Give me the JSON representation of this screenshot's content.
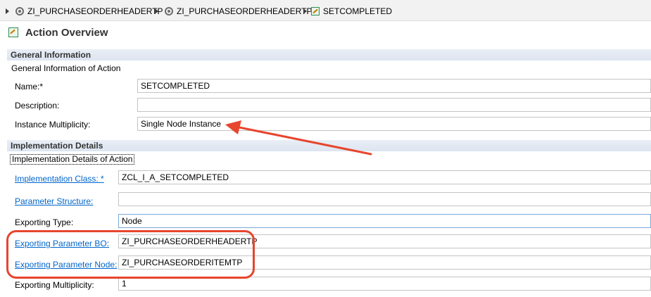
{
  "breadcrumb": {
    "items": [
      {
        "label": "ZI_PURCHASEORDERHEADERTP",
        "icon": "business-object-icon"
      },
      {
        "label": "ZI_PURCHASEORDERHEADERTP",
        "icon": "business-object-icon"
      },
      {
        "label": "SETCOMPLETED",
        "icon": "action-icon"
      }
    ]
  },
  "page": {
    "title": "Action Overview",
    "icon": "action-icon"
  },
  "general": {
    "header": "General Information",
    "description": "General Information of Action",
    "fields": {
      "name": {
        "label": "Name:*",
        "value": "SETCOMPLETED"
      },
      "description": {
        "label": "Description:",
        "value": ""
      },
      "instance_multiplicity": {
        "label": "Instance Multiplicity:",
        "value": "Single Node Instance"
      }
    }
  },
  "implementation": {
    "header": "Implementation Details",
    "description": "Implementation Details of Action",
    "fields": {
      "implementation_class": {
        "label": "Implementation Class: *",
        "value": "ZCL_I_A_SETCOMPLETED"
      },
      "parameter_structure": {
        "label": "Parameter Structure:",
        "value": ""
      },
      "exporting_type": {
        "label": "Exporting Type:",
        "value": "Node"
      },
      "exporting_parameter_bo": {
        "label": "Exporting Parameter BO:",
        "value": "ZI_PURCHASEORDERHEADERTP"
      },
      "exporting_parameter_node": {
        "label": "Exporting Parameter Node:",
        "value": "ZI_PURCHASEORDERITEMTP"
      },
      "exporting_multiplicity": {
        "label": "Exporting Multiplicity:",
        "value": "1"
      }
    }
  },
  "colors": {
    "annotation": "#e7452e",
    "link": "#0066cc",
    "section_bg": "#dde5f1"
  }
}
